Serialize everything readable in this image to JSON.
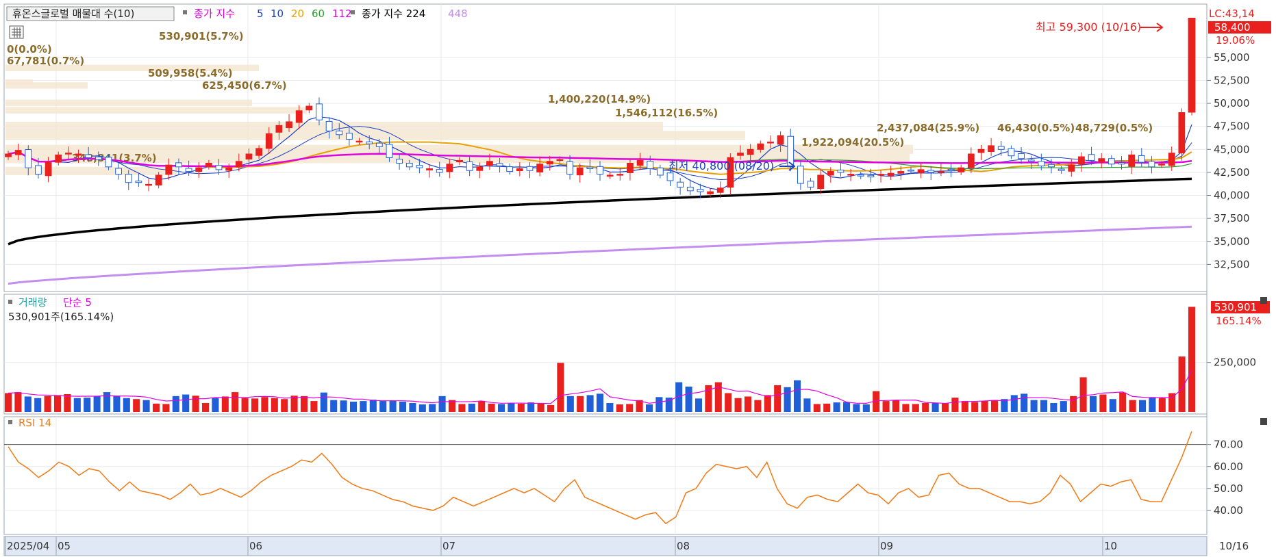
{
  "price_panel": {
    "title": "휴온스글로벌 매물대 수(10)",
    "legend_ma_label": "종가 지수",
    "legend_ma_periods": [
      "5",
      "10",
      "20",
      "60",
      "112"
    ],
    "legend_ma_colors": [
      "#1a3fc4",
      "#1a3fc4",
      "#e8a000",
      "#2a9c2a",
      "#e000e0"
    ],
    "legend_long_label": "종가 지수 224",
    "legend_long2": "448",
    "right_top_label": "LC:43,14",
    "current_price_label": "58,400",
    "change_pct_label": "19.06%",
    "high_annotation": "최고 59,300 (10/16)",
    "low_annotation": "최저 40,800 (08/20)",
    "volume_profile_labels": [
      "530,901(5.7%)",
      "0(0.0%)",
      "67,781(0.7%)",
      "509,958(5.4%)",
      "625,450(6.7%)",
      "348,841(3.7%)",
      "1,400,220(14.9%)",
      "1,546,112(16.5%)",
      "1,922,094(20.5%)",
      "2,437,084(25.9%)",
      "46,430(0.5%)",
      "48,729(0.5%)"
    ],
    "y_ticks": [
      "55,000",
      "52,500",
      "50,000",
      "47,500",
      "45,000",
      "42,500",
      "40,000",
      "37,500",
      "35,000",
      "32,500"
    ]
  },
  "volume_panel": {
    "title_left": "거래량",
    "title_right": "단순 5",
    "info": "530,901주(165.14%)",
    "current_label": "530,901",
    "pct_label": "165.14%",
    "y_ticks": [
      "250,000"
    ]
  },
  "rsi_panel": {
    "title": "RSI 14",
    "y_ticks": [
      "70.00",
      "60.00",
      "50.00",
      "40.00"
    ]
  },
  "x_axis": {
    "labels": [
      "2025/04",
      "05",
      "06",
      "07",
      "08",
      "09",
      "10"
    ],
    "right_label": "10/16"
  },
  "colors": {
    "up": "#e8201e",
    "down": "#1f5fd8",
    "ma5": "#1a3fc4",
    "ma20": "#e8a000",
    "ma60": "#2a9c2a",
    "ma112": "#e000e0",
    "ma224": "#000000",
    "ma448": "#c38ef0",
    "rsi": "#ef7a16",
    "profile": "#f5e6d2"
  },
  "chart_data": {
    "type": "candlestick",
    "close_series": [
      44500,
      44900,
      43000,
      42300,
      43600,
      44400,
      44600,
      44500,
      44100,
      43900,
      43100,
      42300,
      41400,
      41400,
      41200,
      42200,
      43300,
      43100,
      42600,
      43000,
      43500,
      42800,
      43000,
      43700,
      44500,
      45100,
      46700,
      47600,
      48000,
      49200,
      49700,
      48200,
      47000,
      46600,
      46100,
      45900,
      45600,
      45300,
      44100,
      43500,
      43100,
      43000,
      42900,
      42500,
      43400,
      43800,
      42700,
      43100,
      43700,
      43200,
      42600,
      42900,
      42700,
      43400,
      43700,
      43900,
      42300,
      43000,
      42900,
      42300,
      42200,
      42300,
      43500,
      43800,
      42900,
      42200,
      41600,
      40900,
      40500,
      40400,
      40400,
      40800,
      44100,
      44600,
      45000,
      45600,
      45800,
      46500,
      43100,
      41300,
      40900,
      42200,
      42600,
      42500,
      42300,
      42100,
      42000,
      42300,
      42400,
      42600,
      42700,
      42800,
      42500,
      42600,
      42700,
      43000,
      44500,
      45000,
      45400,
      45000,
      44300,
      44000,
      43700,
      43200,
      43100,
      42700,
      43300,
      44200,
      43800,
      44000,
      43400,
      43400,
      44400,
      43600,
      43100,
      43400,
      44600,
      49000,
      58400
    ],
    "ma_periods": [
      5,
      10,
      20,
      60,
      112,
      224,
      448
    ],
    "volume": [
      95000,
      100000,
      78000,
      70000,
      80000,
      85000,
      90000,
      70000,
      72000,
      80000,
      100000,
      80000,
      70000,
      65000,
      60000,
      42000,
      40000,
      80000,
      88000,
      82000,
      45000,
      70000,
      78000,
      100000,
      70000,
      68000,
      75000,
      70000,
      65000,
      82000,
      80000,
      55000,
      98000,
      60000,
      58000,
      52000,
      55000,
      62000,
      55000,
      58000,
      52000,
      45000,
      38000,
      40000,
      80000,
      60000,
      40000,
      42000,
      55000,
      42000,
      40000,
      45000,
      42000,
      48000,
      42000,
      35000,
      248000,
      80000,
      80000,
      85000,
      92000,
      45000,
      38000,
      40000,
      60000,
      38000,
      75000,
      72000,
      150000,
      128000,
      68000,
      135000,
      150000,
      95000,
      70000,
      78000,
      60000,
      85000,
      135000,
      125000,
      160000,
      68000,
      40000,
      42000,
      48000,
      50000,
      40000,
      38000,
      105000,
      55000,
      60000,
      40000,
      40000,
      45000,
      45000,
      45000,
      72000,
      55000,
      50000,
      55000,
      60000,
      65000,
      85000,
      92000,
      60000,
      60000,
      45000,
      55000,
      80000,
      175000,
      80000,
      88000,
      65000,
      98000,
      60000,
      60000,
      75000,
      70000,
      95000,
      280000,
      530901
    ],
    "volume_ma_period": 5,
    "rsi": [
      69,
      62,
      59,
      55,
      58,
      62,
      60,
      56,
      59,
      58,
      53,
      49,
      53,
      49,
      48,
      47,
      45,
      48,
      52,
      47,
      48,
      50,
      48,
      46,
      49,
      53,
      56,
      58,
      60,
      63,
      62,
      66,
      61,
      55,
      52,
      50,
      49,
      47,
      45,
      44,
      42,
      41,
      40,
      42,
      46,
      44,
      42,
      44,
      46,
      48,
      50,
      48,
      50,
      47,
      44,
      50,
      54,
      46,
      44,
      42,
      40,
      38,
      36,
      38,
      39,
      34,
      37,
      48,
      50,
      57,
      61,
      60,
      59,
      60,
      55,
      62,
      50,
      43,
      41,
      46,
      47,
      45,
      44,
      48,
      52,
      48,
      47,
      43,
      48,
      50,
      46,
      47,
      56,
      57,
      52,
      50,
      50,
      48,
      46,
      44,
      44,
      43,
      44,
      48,
      56,
      52,
      44,
      48,
      52,
      51,
      53,
      54,
      45,
      44,
      44,
      54,
      64,
      76
    ],
    "rsi_period": 14,
    "rsi_level": 70,
    "ylim_price": [
      30000,
      59300
    ],
    "ylim_rsi": [
      30,
      78
    ],
    "high": {
      "value": 59300,
      "date": "10/16"
    },
    "low": {
      "value": 40800,
      "date": "08/20"
    }
  }
}
